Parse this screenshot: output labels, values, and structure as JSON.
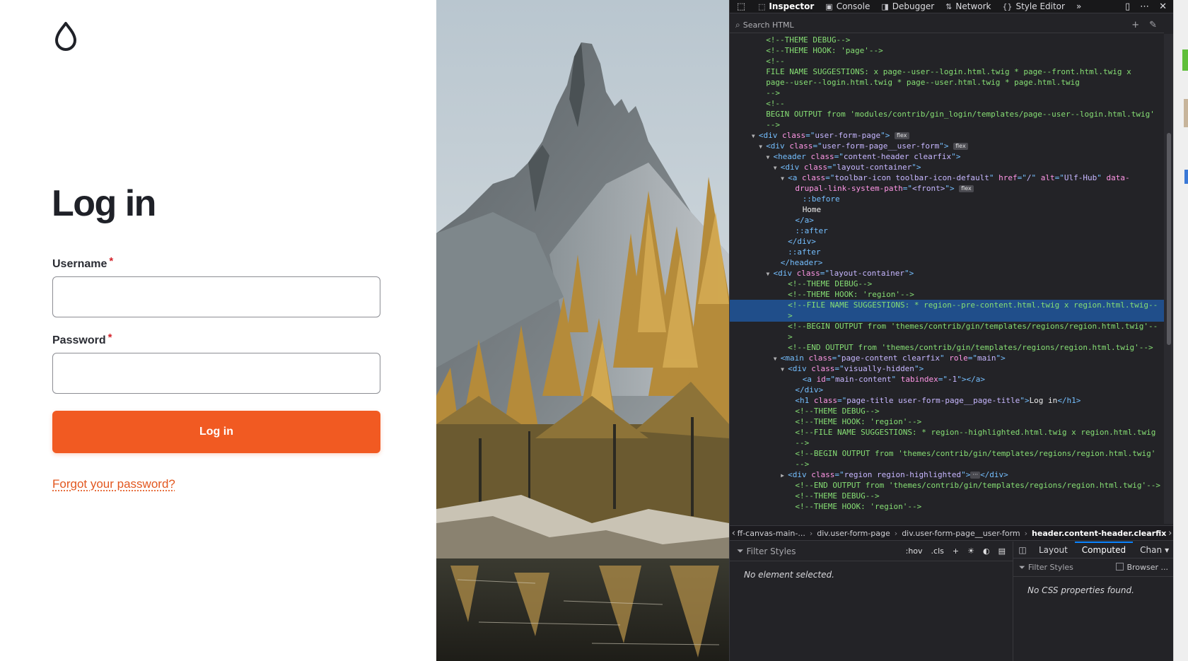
{
  "login": {
    "title": "Log in",
    "username_label": "Username",
    "password_label": "Password",
    "required_mark": "*",
    "username_value": "",
    "password_value": "",
    "submit_label": "Log in",
    "forgot_label": "Forgot your password?",
    "logo_icon": "water-drop-icon",
    "accent_color": "#f15a22"
  },
  "devtools": {
    "tabs": [
      {
        "label": "Inspector",
        "icon": "inspector-icon"
      },
      {
        "label": "Console",
        "icon": "console-icon"
      },
      {
        "label": "Debugger",
        "icon": "debugger-icon"
      },
      {
        "label": "Network",
        "icon": "network-icon"
      },
      {
        "label": "Style Editor",
        "icon": "style-editor-icon"
      }
    ],
    "active_tab": "Inspector",
    "search_placeholder": "Search HTML",
    "markup": [
      {
        "t": "<!--THEME DEBUG-->",
        "k": "com",
        "i": 4
      },
      {
        "t": "<!--THEME HOOK: 'page'-->",
        "k": "com",
        "i": 4
      },
      {
        "t": "<!--",
        "k": "com",
        "i": 4
      },
      {
        "t": "FILE NAME SUGGESTIONS: x page--user--login.html.twig * page--front.html.twig x",
        "k": "com",
        "i": 4
      },
      {
        "t": "page--user--login.html.twig * page--user.html.twig * page.html.twig",
        "k": "com",
        "i": 4
      },
      {
        "t": "-->",
        "k": "com",
        "i": 4
      },
      {
        "t": "<!--",
        "k": "com",
        "i": 4
      },
      {
        "t": "BEGIN OUTPUT from 'modules/contrib/gin_login/templates/page--user--login.html.twig'",
        "k": "com",
        "i": 4
      },
      {
        "t": "-->",
        "k": "com",
        "i": 4
      },
      {
        "k": "tag",
        "i": 3,
        "tw": "open",
        "name": "div",
        "attrs": [
          [
            "class",
            "user-form-page"
          ]
        ],
        "badge": "flex"
      },
      {
        "k": "tag",
        "i": 4,
        "tw": "open",
        "name": "div",
        "attrs": [
          [
            "class",
            "user-form-page__user-form"
          ]
        ],
        "badge": "flex"
      },
      {
        "k": "tag",
        "i": 5,
        "tw": "open",
        "name": "header",
        "attrs": [
          [
            "class",
            "content-header clearfix"
          ]
        ]
      },
      {
        "k": "tag",
        "i": 6,
        "tw": "open",
        "name": "div",
        "attrs": [
          [
            "class",
            "layout-container"
          ]
        ]
      },
      {
        "k": "tag",
        "i": 7,
        "tw": "open",
        "name": "a",
        "attrs": [
          [
            "class",
            "toolbar-icon toolbar-icon-default"
          ],
          [
            "href",
            "/"
          ],
          [
            "alt",
            "Ulf-Hub"
          ]
        ],
        "trail": " data-"
      },
      {
        "k": "cont",
        "i": 8,
        "attrs": [
          [
            "drupal-link-system-path",
            "<front>"
          ]
        ],
        "badge": "flex"
      },
      {
        "t": "::before",
        "k": "pse",
        "i": 9
      },
      {
        "t": "Home",
        "k": "txt",
        "i": 9
      },
      {
        "t": "</a>",
        "k": "tag",
        "i": 8
      },
      {
        "t": "::after",
        "k": "pse",
        "i": 8
      },
      {
        "t": "</div>",
        "k": "tag",
        "i": 7
      },
      {
        "t": "::after",
        "k": "pse",
        "i": 7
      },
      {
        "t": "</header>",
        "k": "tag",
        "i": 6
      },
      {
        "k": "tag",
        "i": 5,
        "tw": "open",
        "name": "div",
        "attrs": [
          [
            "class",
            "layout-container"
          ]
        ]
      },
      {
        "t": "<!--THEME DEBUG-->",
        "k": "com",
        "i": 7
      },
      {
        "t": "<!--THEME HOOK: 'region'-->",
        "k": "com",
        "i": 7
      },
      {
        "t": "<!--FILE NAME SUGGESTIONS: * region--pre-content.html.twig x region.html.twig--",
        "k": "com",
        "i": 7,
        "sel": true
      },
      {
        "t": ">",
        "k": "com",
        "i": 7,
        "sel": true
      },
      {
        "t": "<!--BEGIN OUTPUT from 'themes/contrib/gin/templates/regions/region.html.twig'--",
        "k": "com",
        "i": 7
      },
      {
        "t": ">",
        "k": "com",
        "i": 7
      },
      {
        "t": "<!--END OUTPUT from 'themes/contrib/gin/templates/regions/region.html.twig'-->",
        "k": "com",
        "i": 7
      },
      {
        "k": "tag",
        "i": 6,
        "tw": "open",
        "name": "main",
        "attrs": [
          [
            "class",
            "page-content clearfix"
          ],
          [
            "role",
            "main"
          ]
        ]
      },
      {
        "k": "tag",
        "i": 7,
        "tw": "open",
        "name": "div",
        "attrs": [
          [
            "class",
            "visually-hidden"
          ]
        ]
      },
      {
        "k": "tag",
        "i": 9,
        "name": "a",
        "attrs": [
          [
            "id",
            "main-content"
          ],
          [
            "tabindex",
            "-1"
          ]
        ],
        "close": "</a>"
      },
      {
        "t": "</div>",
        "k": "tag",
        "i": 8
      },
      {
        "k": "tag",
        "i": 8,
        "name": "h1",
        "attrs": [
          [
            "class",
            "page-title user-form-page__page-title"
          ]
        ],
        "inner": "Log in",
        "close": "</h1>"
      },
      {
        "t": "<!--THEME DEBUG-->",
        "k": "com",
        "i": 8
      },
      {
        "t": "<!--THEME HOOK: 'region'-->",
        "k": "com",
        "i": 8
      },
      {
        "t": "<!--FILE NAME SUGGESTIONS: * region--highlighted.html.twig x region.html.twig",
        "k": "com",
        "i": 8
      },
      {
        "t": "-->",
        "k": "com",
        "i": 8
      },
      {
        "t": "<!--BEGIN OUTPUT from 'themes/contrib/gin/templates/regions/region.html.twig'",
        "k": "com",
        "i": 8
      },
      {
        "t": "-->",
        "k": "com",
        "i": 8
      },
      {
        "k": "tag",
        "i": 7,
        "tw": "closed",
        "name": "div",
        "attrs": [
          [
            "class",
            "region region-highlighted"
          ]
        ],
        "collapsed": "···",
        "close": "</div>"
      },
      {
        "t": "<!--END OUTPUT from 'themes/contrib/gin/templates/regions/region.html.twig'-->",
        "k": "com",
        "i": 8
      },
      {
        "t": "<!--THEME DEBUG-->",
        "k": "com",
        "i": 8
      },
      {
        "t": "<!--THEME HOOK: 'region'-->",
        "k": "com",
        "i": 8
      }
    ],
    "breadcrumbs": [
      "ff-canvas-main-...",
      "div.user-form-page",
      "div.user-form-page__user-form",
      "header.content-header.clearfix"
    ],
    "rules_filter_placeholder": "Filter Styles",
    "rules_buttons": [
      ":hov",
      ".cls",
      "+"
    ],
    "no_element": "No element selected.",
    "side_tabs": [
      "Layout",
      "Computed",
      "Chan"
    ],
    "side_active": "Computed",
    "side_filter_placeholder": "Filter Styles",
    "browser_styles_label": "Browser ...",
    "no_css": "No CSS properties found."
  }
}
